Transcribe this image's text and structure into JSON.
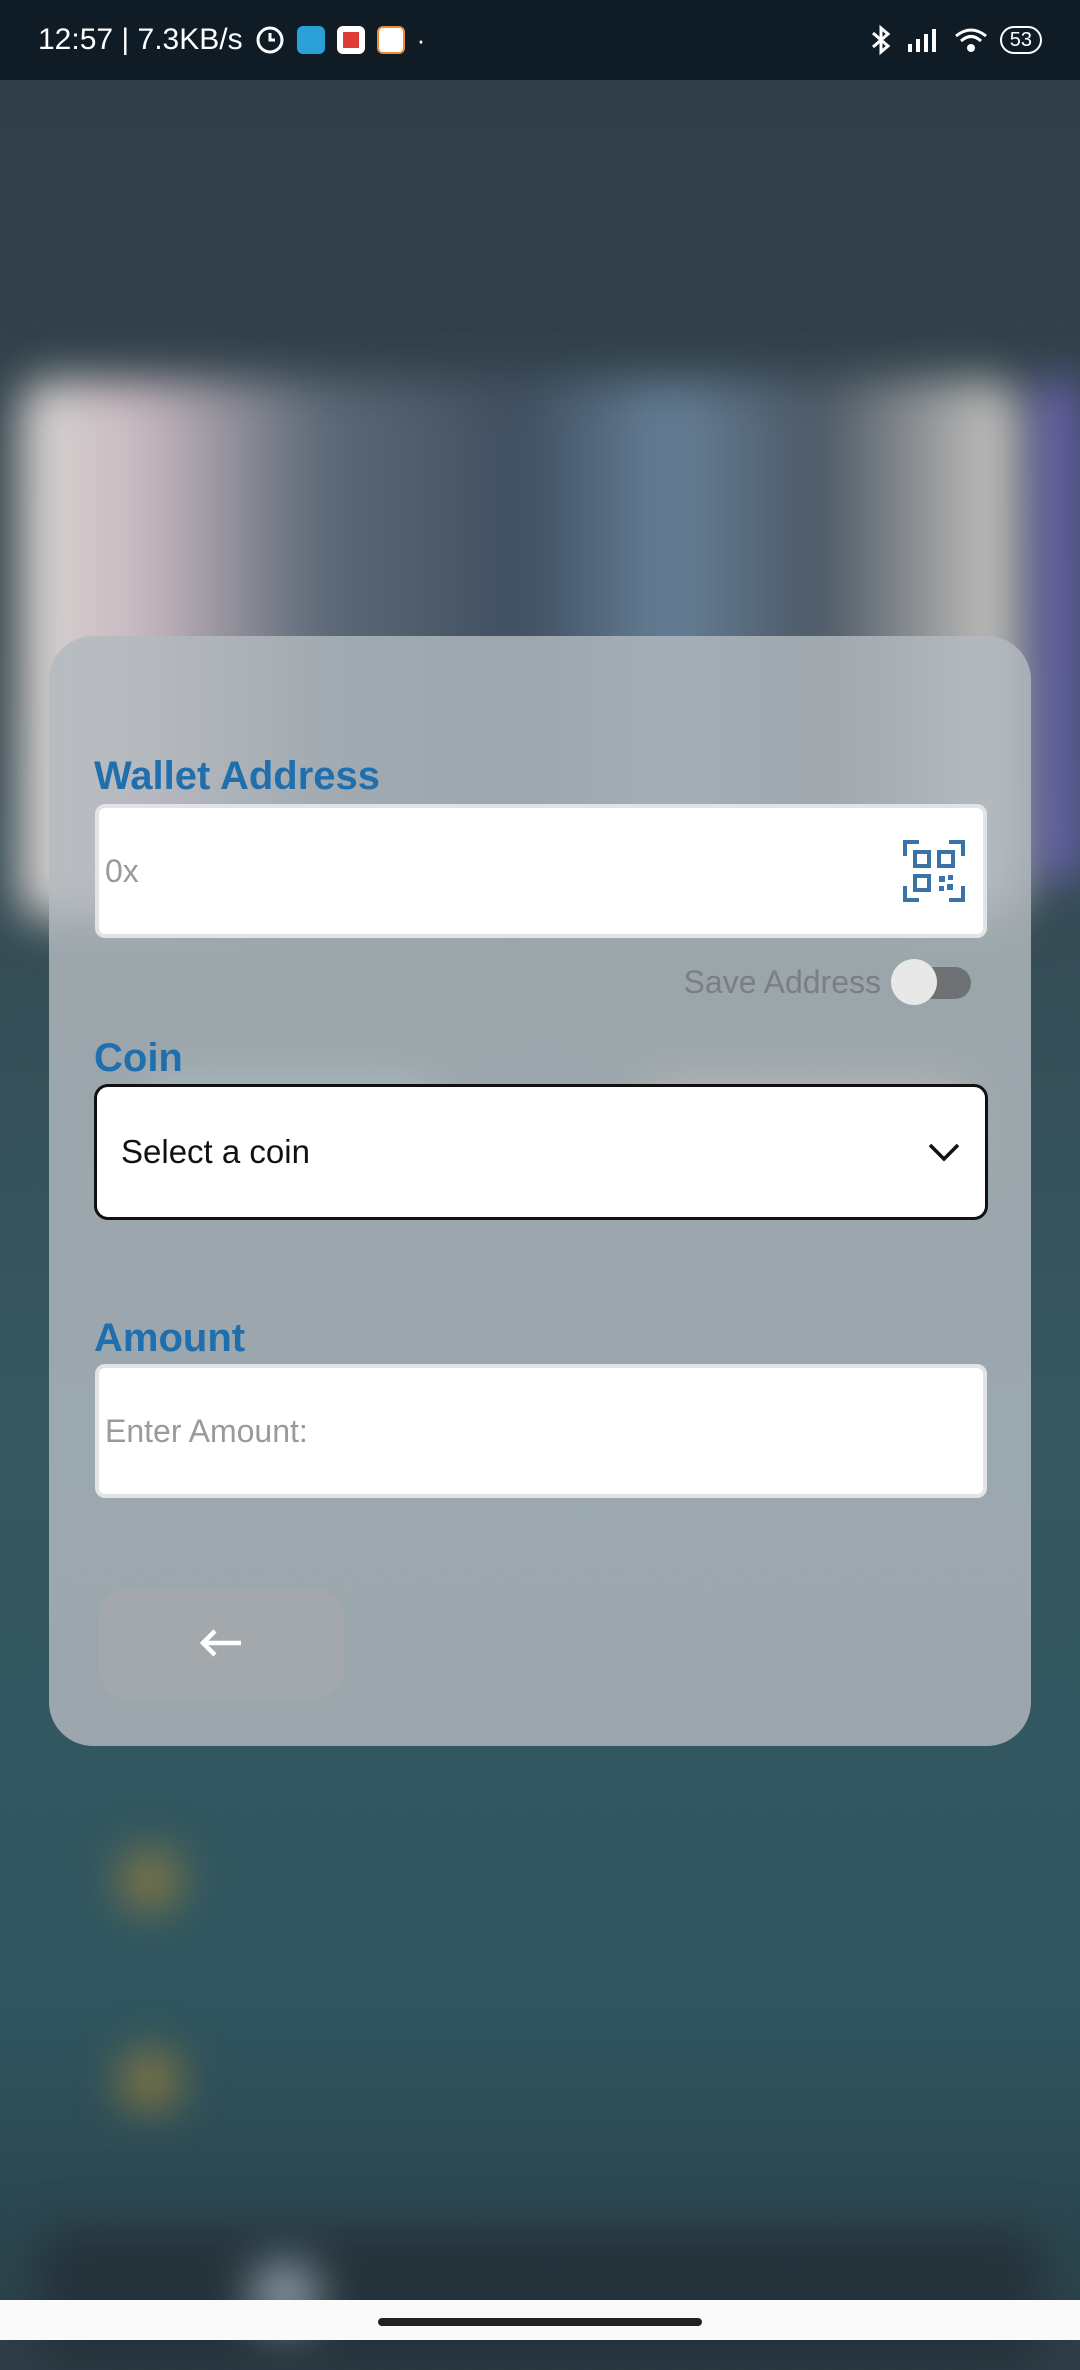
{
  "status_bar": {
    "time_speed": "12:57 | 7.3KB/s",
    "battery": "53"
  },
  "wallet": {
    "label": "Wallet Address",
    "placeholder": "0x",
    "save_label": "Save Address",
    "save_enabled": false
  },
  "coin": {
    "label": "Coin",
    "selected": "Select a coin"
  },
  "amount": {
    "label": "Amount",
    "placeholder": "Enter Amount:"
  },
  "icons": {
    "qr": "qr-scan-icon",
    "back": "arrow-left-icon",
    "dropdown": "chevron-down-icon"
  },
  "colors": {
    "label": "#1f6fae",
    "status_bar": "#0f1c26"
  }
}
